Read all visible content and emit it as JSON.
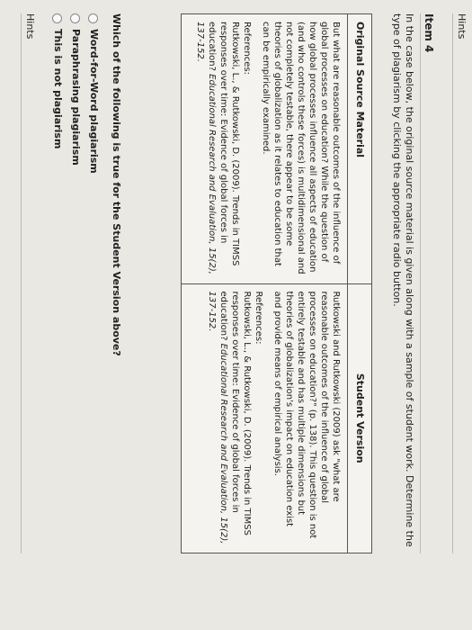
{
  "header": {
    "hints_label": "Hints"
  },
  "item": {
    "title": "Item 4",
    "instructions": "In the case below, the original source material is given along with a sample of student work. Determine the type of plagiarism by clicking the appropriate radio button."
  },
  "table": {
    "col_original": "Original Source Material",
    "col_student": "Student Version",
    "original_text": "But what are reasonable outcomes of the influence of global processes on education? While the question of how global processes influence all aspects of education (and who controls these forces) is multidimensional and not completely testable, there appear to be some theories of globalization as it relates to education that can be empirically examined.",
    "original_refs_label": "References:",
    "original_ref": "Rutkowski, L., & Rutkowski, D. (2009). Trends in TIMSS responses over time: Evidence of global forces in education?",
    "original_ref_journal": "Educational Research and Evaluation, 15(2), 137-152.",
    "student_text": "Rutkowski and Rutkowski (2009) ask \"what are reasonable outcomes of the influence of global processes on education?\" (p. 138). This question is not entirely testable and has multiple dimensions but theories of globalization's impact on education exist and provide means of empirical analysis.",
    "student_refs_label": "References:",
    "student_ref": "Rutkowski, L., & Rutkowski, D. (2009). Trends in TIMSS responses over time: Evidence of global forces in education?",
    "student_ref_journal": "Educational Research and Evaluation, 15(2), 137-152."
  },
  "question": "Which of the following is true for the Student Version above?",
  "options": [
    {
      "label": "Word-for-Word plagiarism"
    },
    {
      "label": "Paraphrasing plagiarism"
    },
    {
      "label": "This is not plagiarism"
    }
  ],
  "footer": {
    "hints_label": "Hints"
  }
}
